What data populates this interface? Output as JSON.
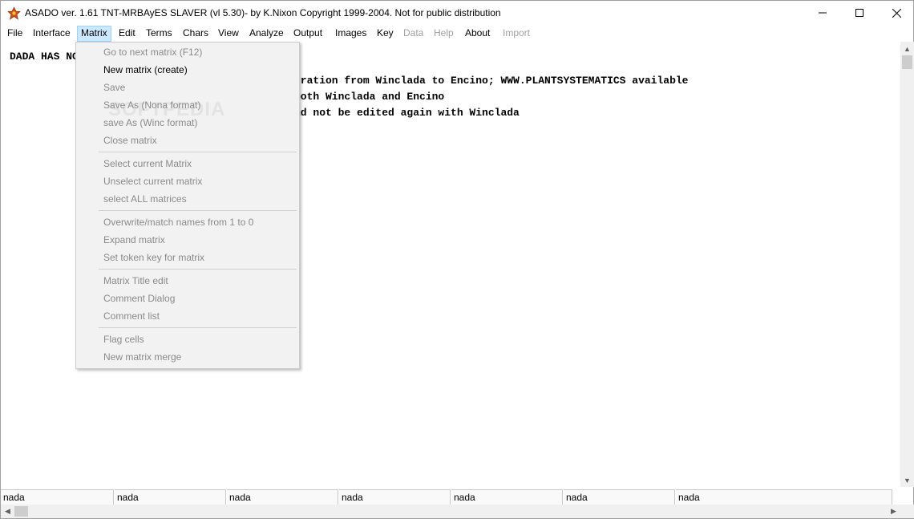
{
  "window": {
    "title": "ASADO ver. 1.61 TNT-MRBAyES SLAVER (vl 5.30)- by K.Nixon Copyright 1999-2004. Not for public distribution",
    "app_icon": "asado-app-icon",
    "controls": {
      "minimize": "─",
      "maximize": "☐",
      "close": "✕"
    }
  },
  "menubar": {
    "items": [
      {
        "label": "File",
        "enabled": true
      },
      {
        "label": "Interface",
        "enabled": true
      },
      {
        "label": "Matrix",
        "enabled": true,
        "active": true
      },
      {
        "label": "Edit",
        "enabled": true
      },
      {
        "label": "Terms",
        "enabled": true
      },
      {
        "label": "Chars",
        "enabled": true
      },
      {
        "label": "View",
        "enabled": true
      },
      {
        "label": "Analyze",
        "enabled": true
      },
      {
        "label": "Output",
        "enabled": true
      },
      {
        "label": "Images",
        "enabled": true
      },
      {
        "label": "Key",
        "enabled": true
      },
      {
        "label": "Data",
        "enabled": false
      },
      {
        "label": "Help",
        "enabled": false
      },
      {
        "label": "About",
        "enabled": true
      },
      {
        "label": "Import",
        "enabled": false
      }
    ]
  },
  "content": {
    "lines": [
      "DADA HAS NO",
      "gration from Winclada to Encino; WWW.PLANTSYSTEMATICS available",
      " both Winclada and Encino",
      "ld not be edited again with Winclada"
    ]
  },
  "matrix_menu": {
    "items": [
      {
        "label": "Go to next matrix (F12)",
        "enabled": false
      },
      {
        "label": "New matrix (create)",
        "enabled": true
      },
      {
        "label": "Save",
        "enabled": false
      },
      {
        "label": "Save As (Nona format)",
        "enabled": false
      },
      {
        "label": "save As (Winc format)",
        "enabled": false
      },
      {
        "label": "Close matrix",
        "enabled": false
      },
      {
        "label": "Select current Matrix",
        "enabled": false
      },
      {
        "label": "Unselect current matrix",
        "enabled": false
      },
      {
        "label": "select ALL matrices",
        "enabled": false
      },
      {
        "label": "Overwrite/match names from 1 to 0",
        "enabled": false
      },
      {
        "label": "Expand matrix",
        "enabled": false
      },
      {
        "label": "Set token key for matrix",
        "enabled": false
      },
      {
        "label": "Matrix Title edit",
        "enabled": false
      },
      {
        "label": "Comment Dialog",
        "enabled": false
      },
      {
        "label": "Comment list",
        "enabled": false
      },
      {
        "label": "Flag cells",
        "enabled": false
      },
      {
        "label": "New matrix merge",
        "enabled": false
      }
    ]
  },
  "statusbar": {
    "cells": [
      "nada",
      "nada",
      "nada",
      "nada",
      "nada",
      "nada",
      "nada"
    ]
  },
  "scrollbars": {
    "up_arrow": "▲",
    "down_arrow": "▼",
    "left_arrow": "◀",
    "right_arrow": "▶"
  },
  "watermark": "SOFTPEDIA"
}
